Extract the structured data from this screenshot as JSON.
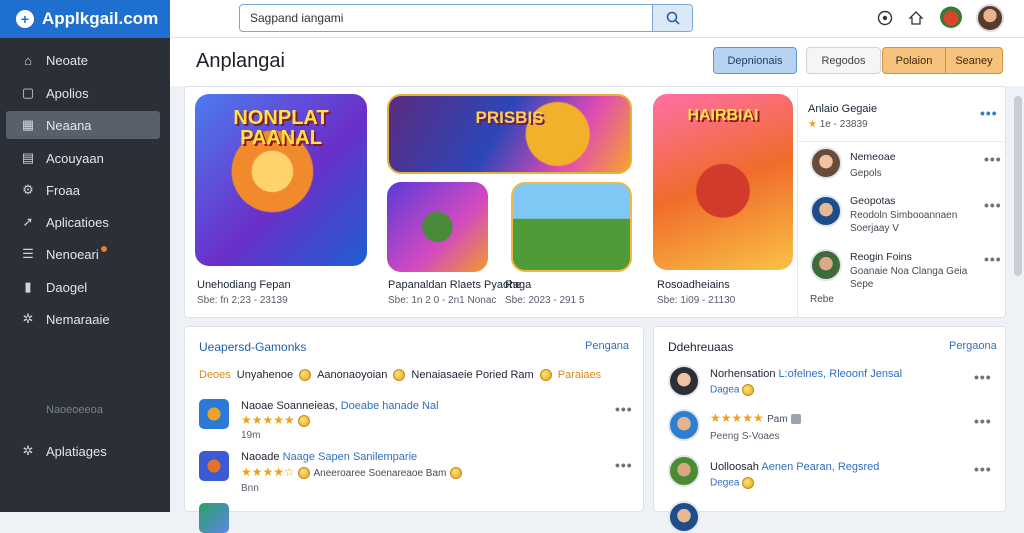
{
  "app": {
    "brand": "Applkgail.com"
  },
  "sidebar": {
    "items": [
      {
        "label": "Neoate",
        "icon": "home-icon"
      },
      {
        "label": "Apolios",
        "icon": "apps-icon"
      },
      {
        "label": "Neaana",
        "icon": "grid-icon"
      },
      {
        "label": "Acouyaan",
        "icon": "library-icon"
      },
      {
        "label": "Froaa",
        "icon": "settings-icon"
      },
      {
        "label": "Aplicatioes",
        "icon": "rocket-icon"
      },
      {
        "label": "Nenoeari",
        "icon": "list-icon"
      },
      {
        "label": "Daogel",
        "icon": "bookmark-icon"
      },
      {
        "label": "Nemaraaie",
        "icon": "gear-icon"
      }
    ],
    "active_index": 2,
    "section_label": "Naoeoeeoa",
    "bottom_item": {
      "label": "Aplatiages",
      "icon": "gear-icon"
    },
    "badge_color": "#e9792c"
  },
  "search": {
    "value": "Sagpand iangami"
  },
  "header": {
    "title": "Anplangai",
    "btn_primary": "Depnionais",
    "btn_secondary": "Regodos",
    "btn_orange_1": "Polaion",
    "btn_orange_2": "Seaney"
  },
  "featured": {
    "art_1_title": "NONPLAT PAANAL",
    "art_2_title": "PRISBIS",
    "art_5_title": "HAIRBIAI",
    "apps": [
      {
        "name": "Unehodiang Fepan",
        "meta": "Sbe: fn 2;23 - 23139"
      },
      {
        "name": "Papanaldan Rlaets Pyaohe",
        "meta": "Sbe: 1n 2 0 - 2n1 Nonac"
      },
      {
        "name": "Raga",
        "meta": "Sbe: 2023 - 291 5"
      },
      {
        "name": "Rosoadheiains",
        "meta": "Sbe: 1i09 - 21130"
      }
    ],
    "side": {
      "title": "Anlaio Gegaie",
      "subtitle": "1e - 23839",
      "items": [
        {
          "title": "Nemeoae",
          "desc": "Gepols"
        },
        {
          "title": "Geopotas",
          "desc": "Reodoln Simbooannaen Soerjaay V"
        },
        {
          "title": "Reogin Foins",
          "desc": "Goanaie Noa Clanga Geia Sepe"
        }
      ],
      "footer": "Rebe"
    }
  },
  "left_card": {
    "title": "Ueapersd-Gamonks",
    "link": "Pengana",
    "tags": [
      "Deoes",
      "Unyahenoe",
      "Aanonaoyoian",
      "Nenaiasaeie Poried Ram",
      "Paraiaes"
    ],
    "rows": [
      {
        "title_prefix": "Naoae Soanneieas,",
        "title_accent": "Doeabe hanade Nal",
        "rating": "★★★★★",
        "sub": "19m"
      },
      {
        "title_prefix": "Naoade",
        "title_accent": "Naage Sapen Sanilemparie",
        "rating": "★★★★☆",
        "rating_note": "Aneeroaree Soenareaoe Bam",
        "sub": "Bnn"
      }
    ]
  },
  "right_card": {
    "title": "Ddehreuaas",
    "link": "Pergaona",
    "rows": [
      {
        "title_prefix": "Norhensation",
        "title_accent": "L:ofelnes, Rleoonf Jensal",
        "sub": "Dagea"
      },
      {
        "title_prefix": "",
        "title_accent": "",
        "rating": "★★★★★",
        "rating_note": "Pam",
        "sub": "Peeng S-Voaes"
      },
      {
        "title_prefix": "Uolloosah",
        "title_accent": "Aenen Pearan, Regsred",
        "sub": "Degea"
      }
    ]
  }
}
